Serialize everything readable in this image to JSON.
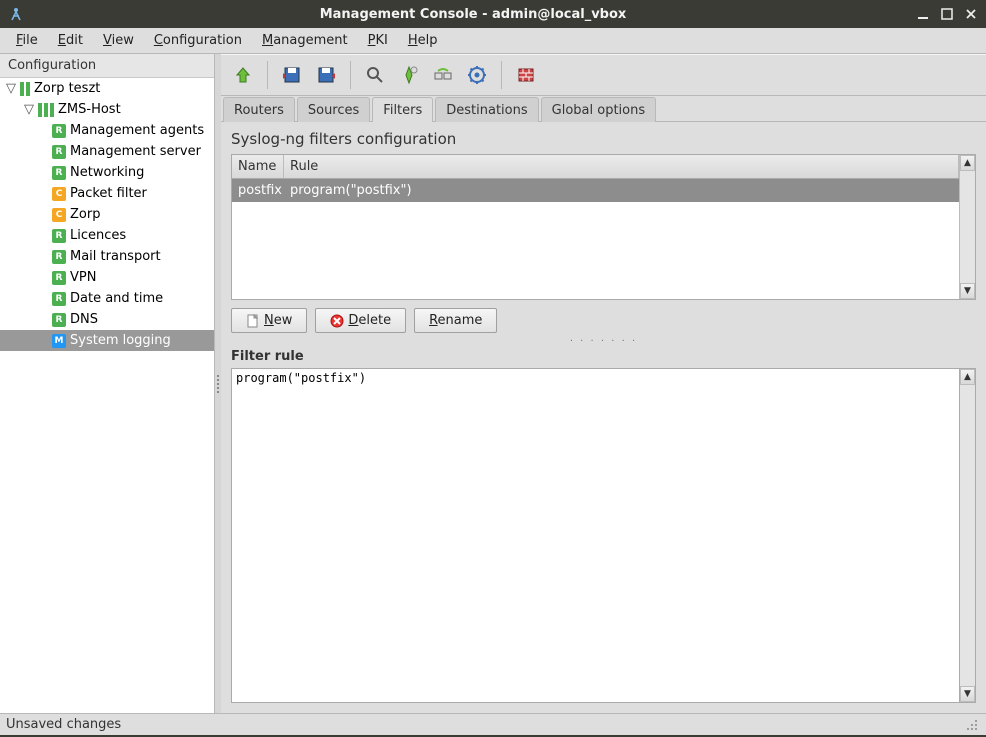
{
  "window": {
    "title": "Management Console - admin@local_vbox"
  },
  "menus": {
    "file": "File",
    "edit": "Edit",
    "view": "View",
    "configuration": "Configuration",
    "management": "Management",
    "pki": "PKI",
    "help": "Help"
  },
  "sidebar": {
    "header": "Configuration",
    "root": {
      "label": "Zorp teszt"
    },
    "host": {
      "label": "ZMS-Host"
    },
    "items": [
      {
        "label": "Management agents",
        "icon": "green",
        "glyph": "R"
      },
      {
        "label": "Management server",
        "icon": "green",
        "glyph": "R"
      },
      {
        "label": "Networking",
        "icon": "green",
        "glyph": "R"
      },
      {
        "label": "Packet filter",
        "icon": "orange",
        "glyph": "C"
      },
      {
        "label": "Zorp",
        "icon": "orange",
        "glyph": "C"
      },
      {
        "label": "Licences",
        "icon": "green",
        "glyph": "R"
      },
      {
        "label": "Mail transport",
        "icon": "green",
        "glyph": "R"
      },
      {
        "label": "VPN",
        "icon": "green",
        "glyph": "R"
      },
      {
        "label": "Date and time",
        "icon": "green",
        "glyph": "R"
      },
      {
        "label": "DNS",
        "icon": "green",
        "glyph": "R"
      },
      {
        "label": "System logging",
        "icon": "blue",
        "glyph": "M",
        "selected": true
      }
    ]
  },
  "tabs": {
    "routers": "Routers",
    "sources": "Sources",
    "filters": "Filters",
    "destinations": "Destinations",
    "global": "Global options",
    "active": "filters"
  },
  "content": {
    "title": "Syslog-ng filters configuration"
  },
  "table": {
    "headers": {
      "name": "Name",
      "rule": "Rule"
    },
    "rows": [
      {
        "name": "postfix",
        "rule": "program(\"postfix\")"
      }
    ]
  },
  "buttons": {
    "new": "New",
    "delete": "Delete",
    "rename": "Rename"
  },
  "filter": {
    "label": "Filter rule",
    "text": "program(\"postfix\")"
  },
  "status": {
    "text": "Unsaved changes"
  }
}
